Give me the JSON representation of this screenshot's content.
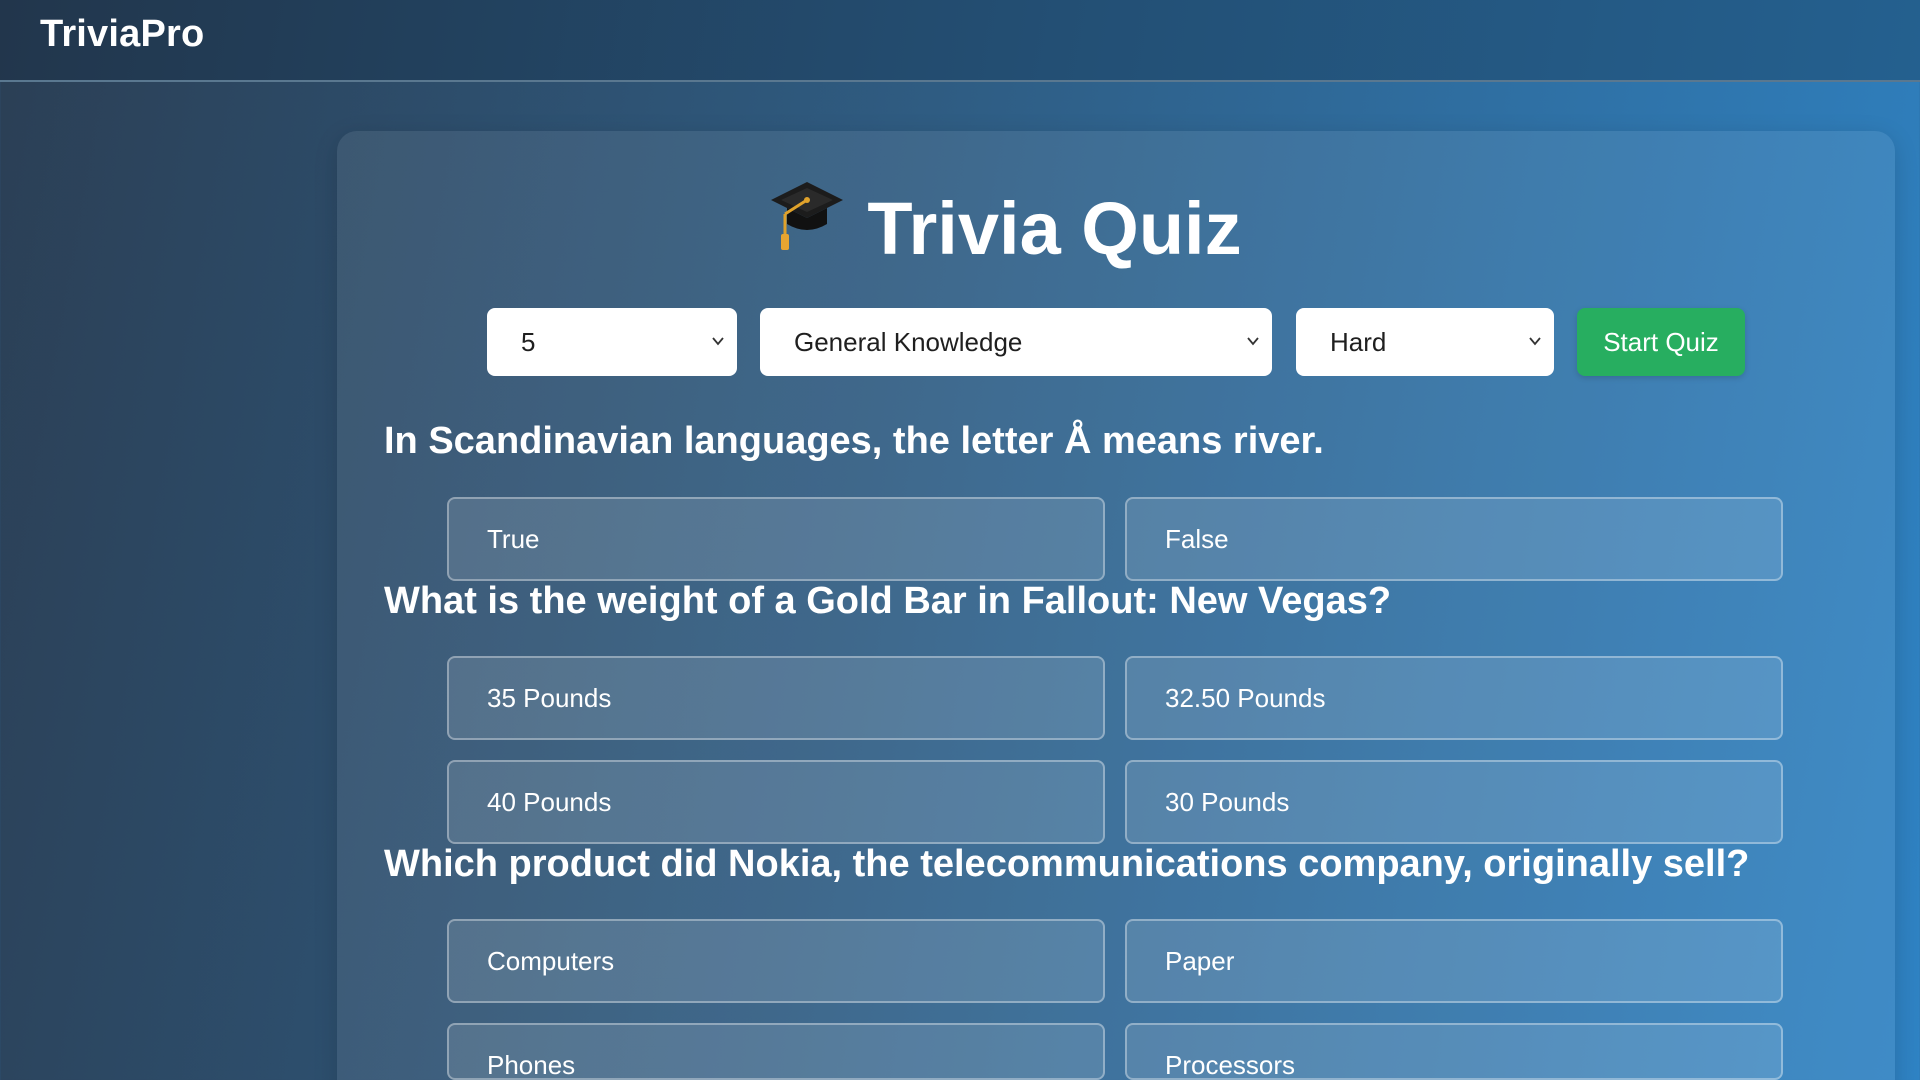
{
  "navbar": {
    "brand": "TriviaPro"
  },
  "quiz": {
    "title": "Trivia Quiz",
    "title_icon": "graduation-cap-icon"
  },
  "controls": {
    "amount": "5",
    "category": "General Knowledge",
    "difficulty": "Hard",
    "start_label": "Start Quiz"
  },
  "questions": [
    {
      "text": "In Scandinavian languages, the letter Å means river.",
      "options": [
        "True",
        "False"
      ]
    },
    {
      "text": "What is the weight of a Gold Bar in Fallout: New Vegas?",
      "options": [
        "35 Pounds",
        "32.50 Pounds",
        "40 Pounds",
        "30 Pounds"
      ]
    },
    {
      "text": "Which product did Nokia, the telecommunications company, originally sell?",
      "options": [
        "Computers",
        "Paper",
        "Phones",
        "Processors"
      ]
    }
  ],
  "colors": {
    "start_button": "#27ae60",
    "background_left": "#2b3f55",
    "background_right": "#2f83c4"
  }
}
